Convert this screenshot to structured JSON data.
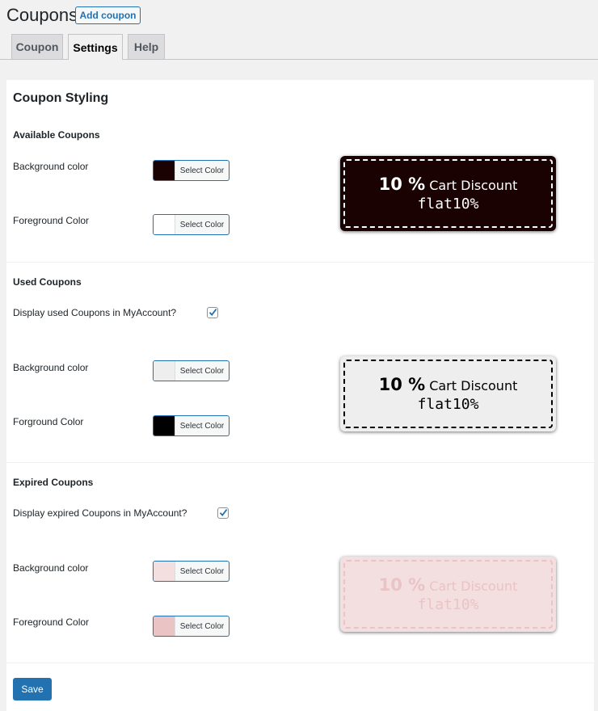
{
  "page": {
    "title": "Coupons",
    "add_button": "Add coupon"
  },
  "tabs": [
    {
      "label": "Coupon",
      "active": false
    },
    {
      "label": "Settings",
      "active": true
    },
    {
      "label": "Help",
      "active": false
    }
  ],
  "section": {
    "title": "Coupon Styling"
  },
  "available": {
    "heading": "Available Coupons",
    "background": {
      "label": "Background color",
      "button": "Select Color",
      "color": "#1a0203"
    },
    "foreground": {
      "label": "Foreground Color",
      "button": "Select Color",
      "color": "#ffffff"
    },
    "preview": {
      "amount": "10 %",
      "description": "Cart Discount",
      "code": "flat10%",
      "bg": "#1a0203",
      "fg": "#ffffff"
    }
  },
  "used": {
    "heading": "Used Coupons",
    "display_label": "Display used Coupons in MyAccount?",
    "display_checked": true,
    "background": {
      "label": "Background color",
      "button": "Select Color",
      "color": "#eeeeee"
    },
    "foreground": {
      "label": "Forground Color",
      "button": "Select Color",
      "color": "#000000"
    },
    "preview": {
      "amount": "10 %",
      "description": "Cart Discount",
      "code": "flat10%",
      "bg": "#eeeeee",
      "fg": "#000000"
    }
  },
  "expired": {
    "heading": "Expired Coupons",
    "display_label": "Display expired Coupons in MyAccount?",
    "display_checked": true,
    "background": {
      "label": "Background color",
      "button": "Select Color",
      "color": "#f3dfe0"
    },
    "foreground": {
      "label": "Foreground Color",
      "button": "Select Color",
      "color": "#eac3c4"
    },
    "preview": {
      "amount": "10 %",
      "description": "Cart Discount",
      "code": "flat10%",
      "bg": "#f3dfe0",
      "fg": "#eac3c4"
    }
  },
  "save_label": "Save"
}
